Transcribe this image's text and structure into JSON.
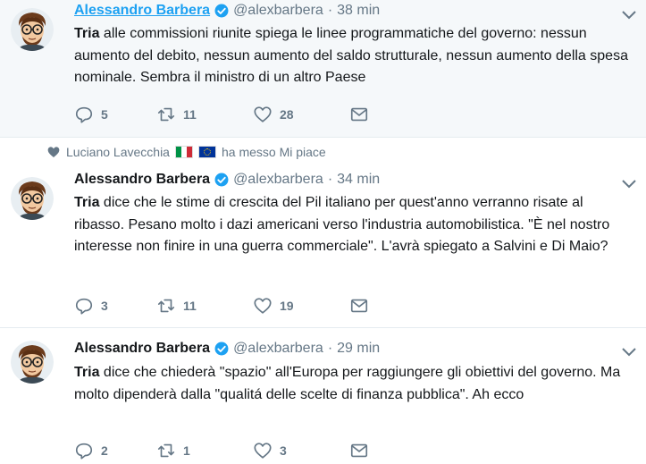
{
  "author": {
    "name": "Alessandro Barbera",
    "handle": "@alexbarbera"
  },
  "tweets": [
    {
      "time": "38 min",
      "lead": "Tria",
      "body": " alle commissioni riunite spiega le linee programmatiche del governo: nessun aumento del debito, nessun aumento del saldo strutturale, nessun aumento della spesa nominale. Sembra il ministro di un altro Paese",
      "replies": "5",
      "retweets": "11",
      "likes": "28"
    },
    {
      "social_user": "Luciano Lavecchia",
      "social_action": "ha messo Mi piace",
      "time": "34 min",
      "lead": "Tria",
      "body": " dice che le stime di crescita del Pil italiano per quest'anno verranno risate al ribasso. Pesano molto i dazi americani verso l'industria automobilistica. \"È nel nostro interesse non finire in una guerra commerciale\". L'avrà spiegato a Salvini e Di Maio?",
      "replies": "3",
      "retweets": "11",
      "likes": "19"
    },
    {
      "time": "29 min",
      "lead": "Tria",
      "body": " dice che chiederà \"spazio\" all'Europa per raggiungere gli obiettivi del governo. Ma molto dipenderà dalla \"qualitá delle scelte di finanza pubblica\". Ah ecco",
      "replies": "2",
      "retweets": "1",
      "likes": "3"
    }
  ],
  "colors": {
    "link": "#1da1f2",
    "muted": "#657786",
    "text": "#14171a",
    "verified": "#1da1f2",
    "highlight_bg": "#f5f8fa"
  },
  "icons": [
    "reply-icon",
    "retweet-icon",
    "like-icon",
    "direct-message-icon",
    "verified-badge-icon",
    "chevron-down-icon",
    "heart-icon"
  ]
}
